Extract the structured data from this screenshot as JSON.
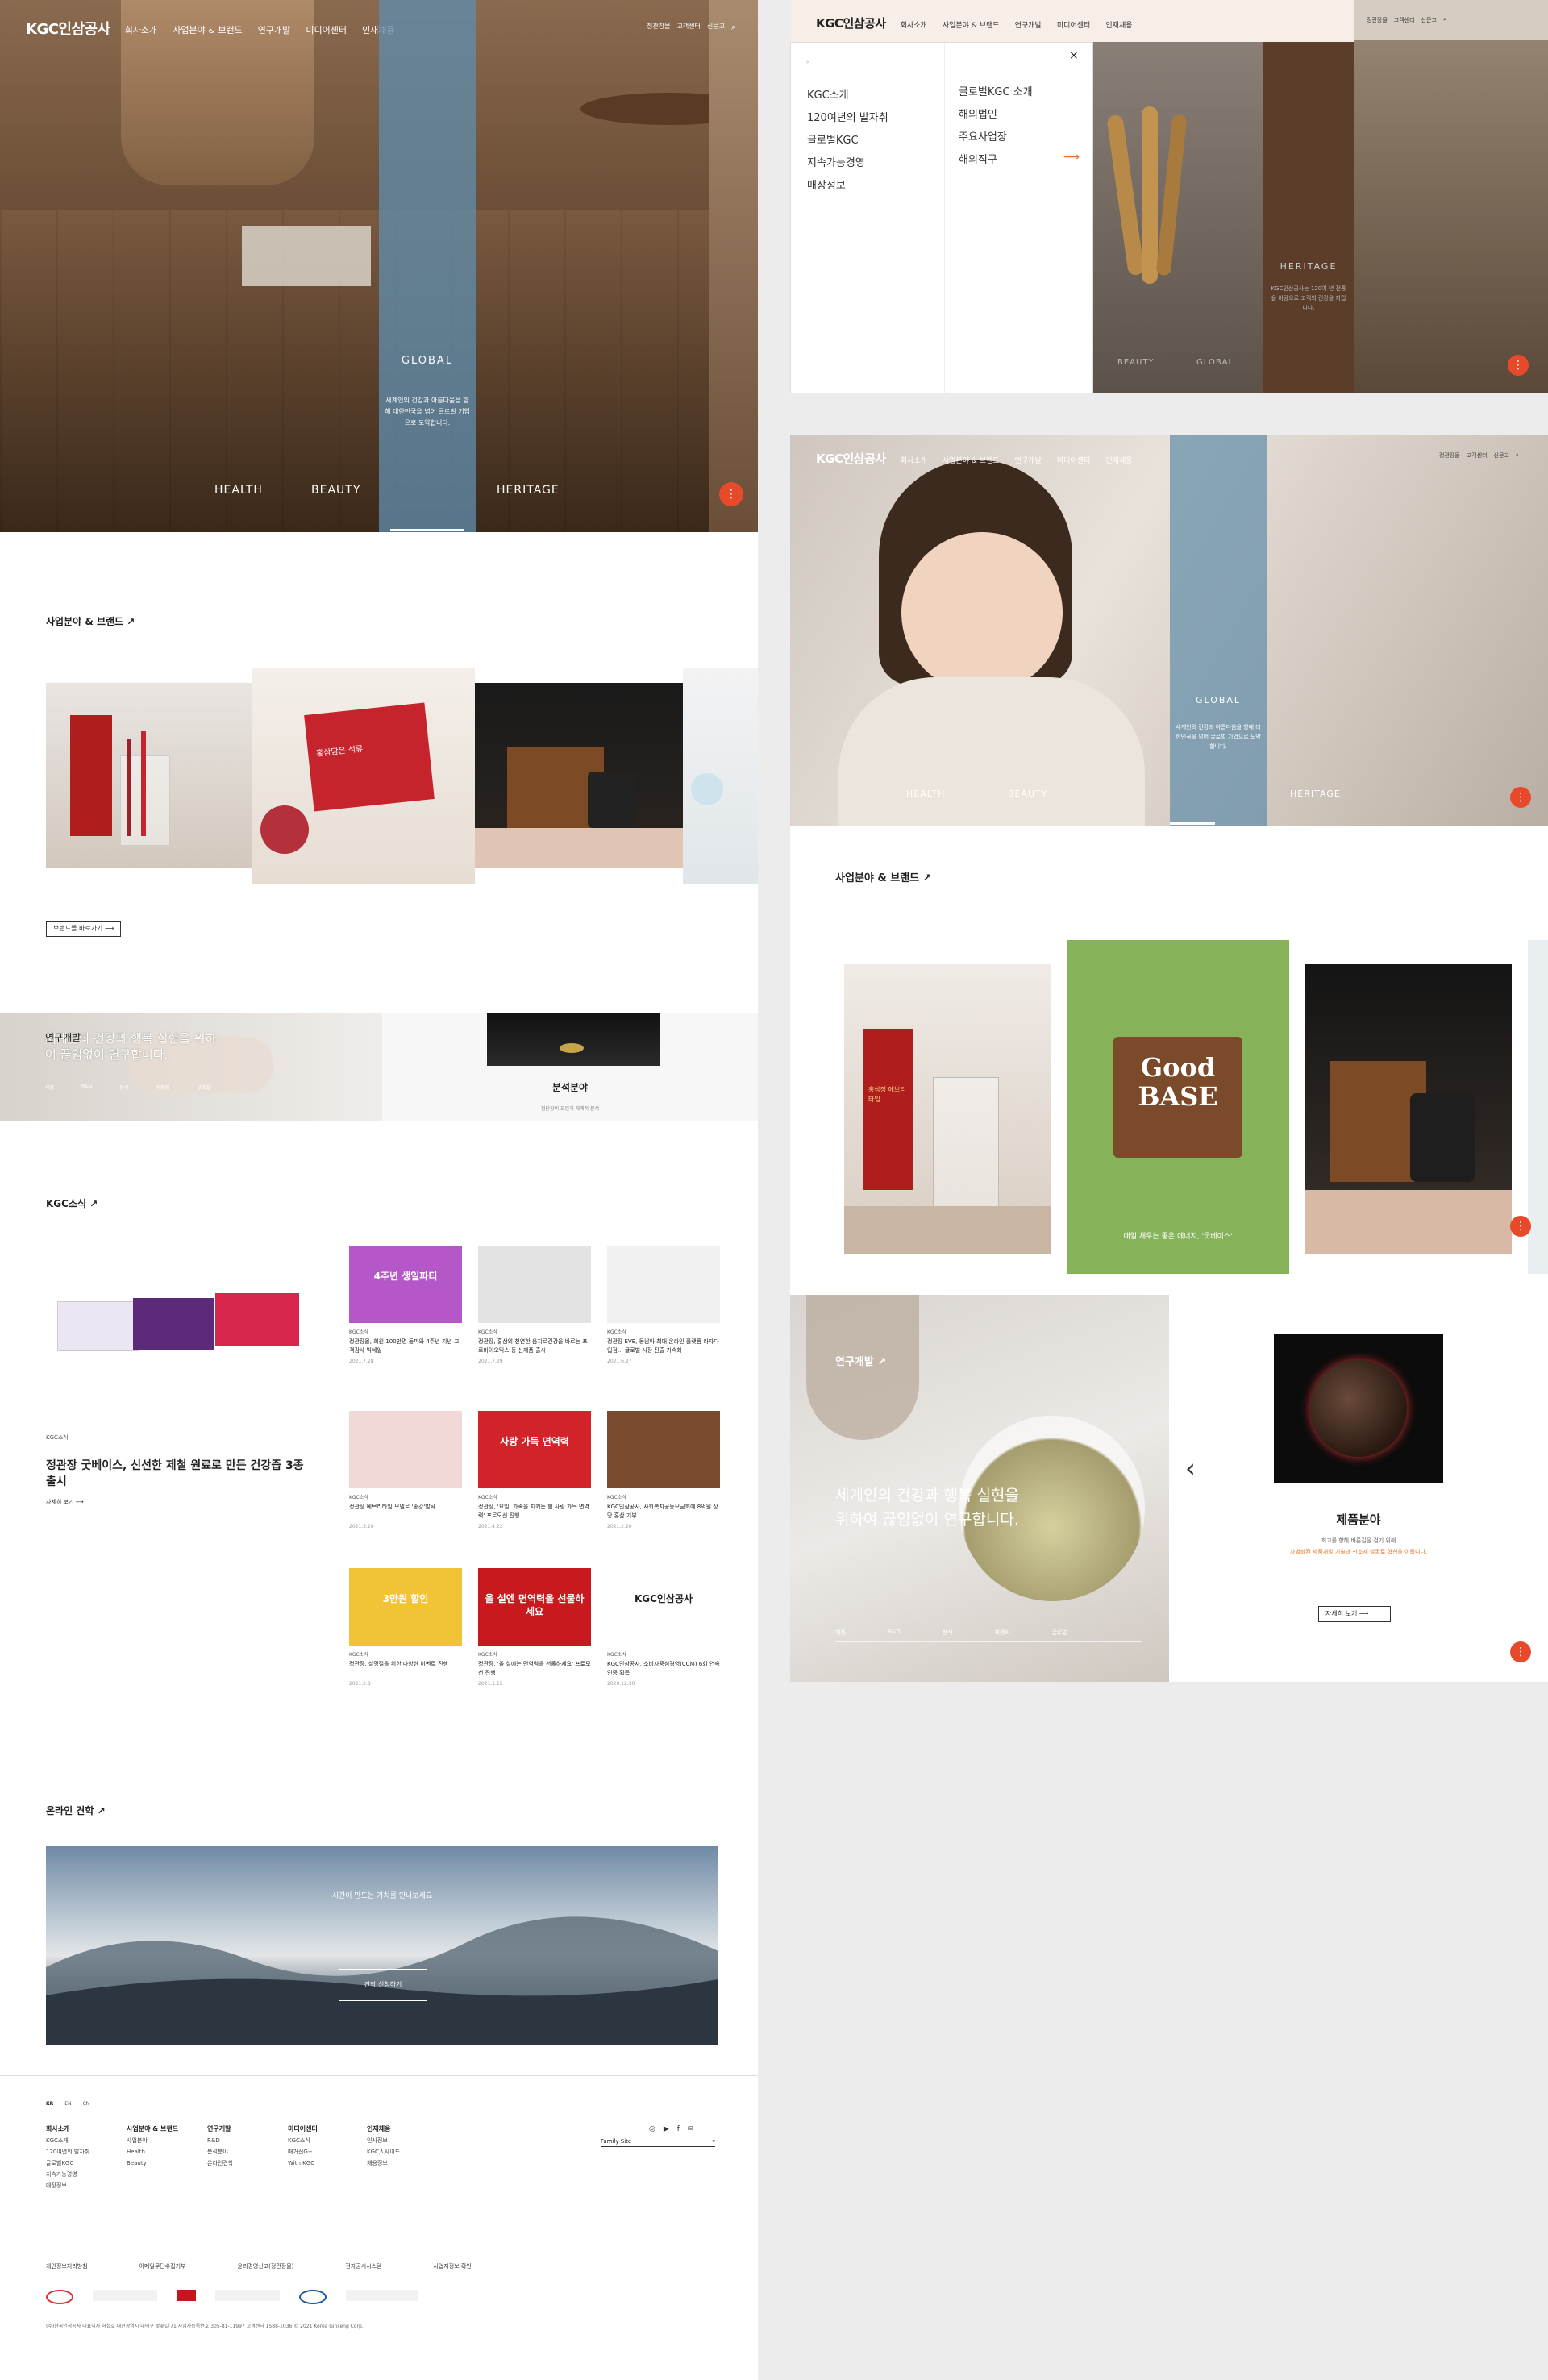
{
  "header": {
    "logo_text": "KGC인삼공사",
    "menu": [
      "회사소개",
      "사업분야 & 브랜드",
      "연구개발",
      "미디어센터",
      "인재채용"
    ],
    "top_links": [
      "정관장몰",
      "고객센터",
      "신문고"
    ]
  },
  "hero": {
    "band_title": "GLOBAL",
    "band_desc": "세계인의 건강과 아름다움을 향해 대한민국을 넘어 글로벌 기업으로 도약합니다.",
    "categories": [
      "HEALTH",
      "BEAUTY",
      "HERITAGE"
    ],
    "fab": "⋮"
  },
  "dropdown": {
    "left_items": [
      "KGC소개",
      "120여년의 발자취",
      "글로벌KGC",
      "지속가능경영",
      "매장정보"
    ],
    "right_items": [
      "글로벌KGC 소개",
      "해외법인",
      "주요사업장",
      "해외직구"
    ],
    "close": "×",
    "heritage_title": "HERITAGE",
    "heritage_desc": "KGC인삼공사는 120여 년 전통을 바탕으로 고객의 건강을 지킵니다.",
    "bottom_labels": [
      "BEAUTY",
      "GLOBAL"
    ]
  },
  "business": {
    "title": "사업분야 & 브랜드",
    "more_button": "브랜드몰 바로가기",
    "goodbase_brand": "Good BASE",
    "goodbase_caption": "매일 채우는 좋은 에너지, '굿베이스'",
    "product_label_a": "홍삼정 에브리타임",
    "product_label_b": "홍삼담은 석류"
  },
  "research": {
    "title": "연구개발",
    "headline": "세계인의 건강과 행복 실현을 위하여 끊임없이 연구합니다.",
    "tabs": [
      "제품",
      "R&D",
      "분석",
      "제품화",
      "글로벌"
    ],
    "side_title": "분석분야",
    "side_desc": "첨단장비 도입과 체계적 분석",
    "product_title": "제품분야",
    "product_desc_1": "회고를 향해 바른길을 걷기 위해",
    "product_desc_2": "차별화된 제품개발 기술과 신소재 발굴로 혁신을 이룹니다.",
    "product_more": "자세히 보기",
    "prev_arrow": "‹"
  },
  "news": {
    "title": "KGC소식",
    "featured": {
      "category": "KGC소식",
      "title": "정관장 굿베이스, 신선한 제철 원료로 만든 건강즙 3종 출시",
      "more": "자세히 보기"
    },
    "items": [
      {
        "cat": "KGC소식",
        "title": "정관장몰, 회원 100만명 돌파와 4주년 기념 고객감사 빅세일",
        "date": "2021.7.28",
        "thumb_text": "4주년 생일파티",
        "color": "#b556c9"
      },
      {
        "cat": "KGC소식",
        "title": "정관장, 홍삼의 천연한 음지로건강을 바르는 프로바이오틱스 등 신제품 출시",
        "date": "2021.7.29",
        "thumb_text": "",
        "color": "#e3e3e3"
      },
      {
        "cat": "KGC소식",
        "title": "정관장 EVE, 동남아 최대 온라인 플랫폼 라자다 입점... 글로벌 시장 진출 가속화",
        "date": "2021.6.27",
        "thumb_text": "",
        "color": "#f1f1f1"
      },
      {
        "cat": "KGC소식",
        "title": "정관장 에브리타임 모델로 '송강'발탁",
        "date": "2021.5.20",
        "thumb_text": "",
        "color": "#f3d8d8"
      },
      {
        "cat": "KGC소식",
        "title": "정관장, '요일, 가족을 지키는 힘 사랑 가득 면역력' 프로모션 진행",
        "date": "2021.4.22",
        "thumb_text": "사랑 가득 면역력",
        "color": "#d2232a"
      },
      {
        "cat": "KGC소식",
        "title": "KGC인삼공사, 사회복지공동모금회에 8억원 상당 홍삼 기부",
        "date": "2021.2.20",
        "thumb_text": "",
        "color": "#7a4a2f"
      },
      {
        "cat": "KGC소식",
        "title": "정관장, 설명절을 위한 다양한 이벤트 진행",
        "date": "2021.2.8",
        "thumb_text": "3만원 할인",
        "color": "#f2c335"
      },
      {
        "cat": "KGC소식",
        "title": "정관장, '올 설에는 면역력을 선물하세요' 프로모션 진행",
        "date": "2021.1.15",
        "thumb_text": "올 설엔 면역력을 선물하세요",
        "color": "#c8191f"
      },
      {
        "cat": "KGC소식",
        "title": "KGC인삼공사, 소비자중심경영(CCM) 6회 연속 인증 획득",
        "date": "2020.12.30",
        "thumb_text": "KGC인삼공사",
        "color": "#ffffff"
      }
    ]
  },
  "online": {
    "title": "온라인 견학",
    "overlay_text": "시간이 만드는 가치를 만나보세요",
    "button": "견학 신청하기"
  },
  "footer": {
    "langs": [
      "KR",
      "EN",
      "CN"
    ],
    "columns": [
      {
        "title": "회사소개",
        "items": [
          "KGC소개",
          "120여년의 발자취",
          "글로벌KGC",
          "지속가능경영",
          "매장정보"
        ]
      },
      {
        "title": "사업분야 & 브랜드",
        "items": [
          "사업분야",
          "Health",
          "Beauty"
        ]
      },
      {
        "title": "연구개발",
        "items": [
          "R&D",
          "분석분야",
          "온라인견학"
        ]
      },
      {
        "title": "미디어센터",
        "items": [
          "KGC소식",
          "매거진G+",
          "With KGC"
        ]
      },
      {
        "title": "인재채용",
        "items": [
          "인사정보",
          "KGC人사이드",
          "채용정보"
        ]
      }
    ],
    "family_site": "Family Site",
    "bottom_links": [
      "개인정보처리방침",
      "이메일무단수집거부",
      "윤리경영신고(정관장몰)",
      "전자공시시스템",
      "사업자정보 확인"
    ],
    "copyright": "(주)한국인삼공사 대표이사 허철호 대전광역시 대덕구 벚꽃길 71 사업자등록번호 305-81-11997 고객센터 1588-1036 © 2021 Korea Ginseng Corp."
  }
}
